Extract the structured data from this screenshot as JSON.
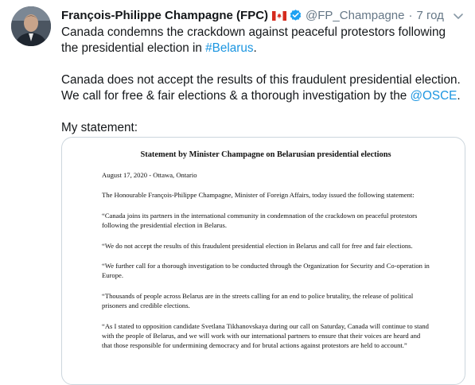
{
  "tweet": {
    "author_name": "François-Philippe Champagne (FPC)",
    "handle": "@FP_Champagne",
    "separator": "·",
    "time": "7 год",
    "line1_pre": "Canada condemns the crackdown against peaceful protestors following the presidential election in ",
    "line1_link": "#Belarus",
    "line1_post": ".",
    "line2_pre": "Canada does not accept the results of this fraudulent presidential election. We call for free & fair elections & a thorough investigation by the ",
    "line2_link": "@OSCE",
    "line2_post": ".",
    "line3": "My statement:",
    "icons": {
      "flag": "canada-flag-icon",
      "verified": "verified-badge-icon",
      "menu": "chevron-down-icon"
    },
    "colors": {
      "link": "#1b95e0",
      "verified": "#1da1f2",
      "muted": "#657786"
    }
  },
  "statement": {
    "title": "Statement by Minister Champagne on Belarusian presidential elections",
    "dateline": "August 17, 2020 - Ottawa, Ontario",
    "paragraphs": [
      "The Honourable François-Philippe Champagne, Minister of Foreign Affairs, today issued the following statement:",
      "“Canada joins its partners in the international community in condemnation of the crackdown on peaceful protestors following the presidential election in Belarus.",
      "“We do not accept the results of this fraudulent presidential election in Belarus and call for free and fair elections.",
      "“We further call for a thorough investigation to be conducted through the Organization for Security and Co-operation in Europe.",
      "“Thousands of people across Belarus are in the streets calling for an end to police brutality, the release of political prisoners and credible elections.",
      "“As I stated to opposition candidate Svetlana Tikhanovskaya during our call on Saturday, Canada will continue to stand with the people of Belarus, and we will work with our international partners to ensure that their voices are heard and that those responsible for undermining democracy and for brutal actions against protestors are held to account.”"
    ]
  }
}
